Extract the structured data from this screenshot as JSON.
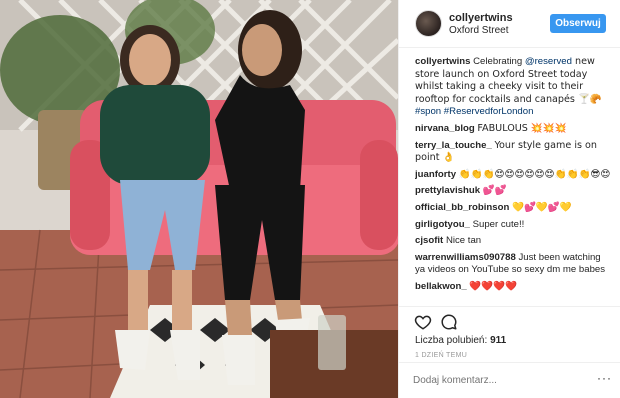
{
  "post": {
    "username": "collyertwins",
    "location": "Oxford Street",
    "follow_label": "Obserwuj"
  },
  "photo": {
    "icon": "photo-two-women-on-pink-sofa"
  },
  "comments": [
    {
      "user": "collyertwins",
      "text_before": "Celebrating ",
      "mention": "@reserved",
      "text_after": " new store launch on Oxford Street today whilst taking a cheeky visit to their rooftop for cocktails and canapés 🍸🥐",
      "tags": "#spon #ReservedforLondon"
    },
    {
      "user": "nirvana_blog",
      "text": "FABULOUS 💥💥💥"
    },
    {
      "user": "terry_la_touche_",
      "text": "Your style game is on point 👌"
    },
    {
      "user": "juanforty",
      "text": "👏👏👏😍😍😍😍😍😍👏👏👏😎😍"
    },
    {
      "user": "prettylavishuk",
      "text": "💕💕"
    },
    {
      "user": "official_bb_robinson",
      "text": "💛💕💛💕💛"
    },
    {
      "user": "girligotyou_",
      "text": "Super cute!!"
    },
    {
      "user": "cjsofit",
      "text": "Nice tan"
    },
    {
      "user": "warrenwilliams090788",
      "text": "Just been watching ya videos on YouTube so sexy dm me babes"
    },
    {
      "user": "bellakwon_",
      "text": "❤️❤️❤️❤️"
    }
  ],
  "actions": {
    "like_icon": "heart-icon",
    "comment_icon": "comment-icon",
    "likes_label": "Liczba polubień:",
    "likes_count": "911",
    "timestamp": "1 DZIEŃ TEMU"
  },
  "add_comment": {
    "placeholder": "Dodaj komentarz...",
    "more": "···"
  },
  "colors": {
    "follow_button": "#3897f0",
    "sofa": "#e05a6b",
    "link": "#003569"
  }
}
